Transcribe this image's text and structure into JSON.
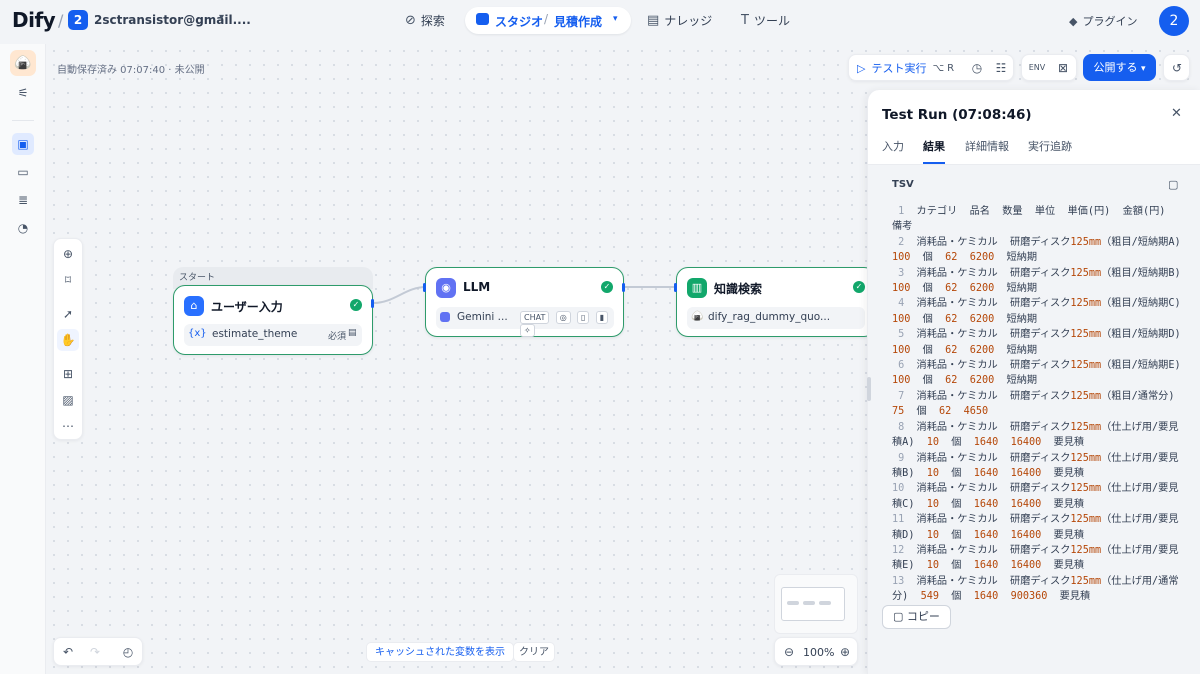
{
  "topbar": {
    "logo": "Dify",
    "workspace_badge": "2",
    "workspace_name": "2sctransistor@gmail....",
    "nav": {
      "explore": "探索",
      "studio": "スタジオ",
      "app_name": "見積作成",
      "knowledge": "ナレッジ",
      "tools": "ツール"
    },
    "plugins": "プラグイン",
    "avatar": "2"
  },
  "editor": {
    "autosave": "自動保存済み 07:07:40 · 未公開",
    "test_run_label": "テスト実行",
    "test_run_shortcut": "⌥ R",
    "publish_label": "公開する"
  },
  "nodes": {
    "start": {
      "tag": "スタート",
      "title": "ユーザー入力",
      "var_name": "estimate_theme",
      "required": "必須"
    },
    "llm": {
      "title": "LLM",
      "model": "Gemini ...",
      "mode": "CHAT"
    },
    "kb": {
      "title": "知識検索",
      "dataset": "dify_rag_dummy_quo..."
    }
  },
  "bottom": {
    "cache_vars": "キャッシュされた変数を表示",
    "clear": "クリア",
    "zoom": "100%"
  },
  "panel": {
    "title": "Test Run (07:08:46)",
    "tabs": [
      "入力",
      "結果",
      "詳細情報",
      "実行追跡"
    ],
    "active_tab": "結果",
    "result_header": "TSV",
    "copy_label": "コピー",
    "tsv_lines": [
      "カテゴリ\t品名\t数量\t単位\t単価(円)\t金額(円)\t備考",
      "消耗品・ケミカル\t研磨ディスク125mm（粗目/短納期A)\t100\t個\t62\t6200\t短納期",
      "消耗品・ケミカル\t研磨ディスク125mm（粗目/短納期B)\t100\t個\t62\t6200\t短納期",
      "消耗品・ケミカル\t研磨ディスク125mm（粗目/短納期C)\t100\t個\t62\t6200\t短納期",
      "消耗品・ケミカル\t研磨ディスク125mm（粗目/短納期D)\t100\t個\t62\t6200\t短納期",
      "消耗品・ケミカル\t研磨ディスク125mm（粗目/短納期E)\t100\t個\t62\t6200\t短納期",
      "消耗品・ケミカル\t研磨ディスク125mm（粗目/通常分)\t75\t個\t62\t4650\t",
      "消耗品・ケミカル\t研磨ディスク125mm（仕上げ用/要見積A)\t10\t個\t1640\t16400\t要見積",
      "消耗品・ケミカル\t研磨ディスク125mm（仕上げ用/要見積B)\t10\t個\t1640\t16400\t要見積",
      "消耗品・ケミカル\t研磨ディスク125mm（仕上げ用/要見積C)\t10\t個\t1640\t16400\t要見積",
      "消耗品・ケミカル\t研磨ディスク125mm（仕上げ用/要見積D)\t10\t個\t1640\t16400\t要見積",
      "消耗品・ケミカル\t研磨ディスク125mm（仕上げ用/要見積E)\t10\t個\t1640\t16400\t要見積",
      "消耗品・ケミカル\t研磨ディスク125mm（仕上げ用/通常分)\t549\t個\t1640\t900360\t要見積"
    ]
  },
  "colors": {
    "accent": "#155eef",
    "success": "#12a76b",
    "number": "#b54708"
  },
  "icons": {
    "explore": "compass-icon",
    "studio": "robot-icon",
    "knowledge": "book-icon",
    "tools": "wrench-icon",
    "plugins": "cube-icon",
    "start": "home-icon",
    "llm": "brain-icon",
    "kb": "book-open-icon"
  }
}
